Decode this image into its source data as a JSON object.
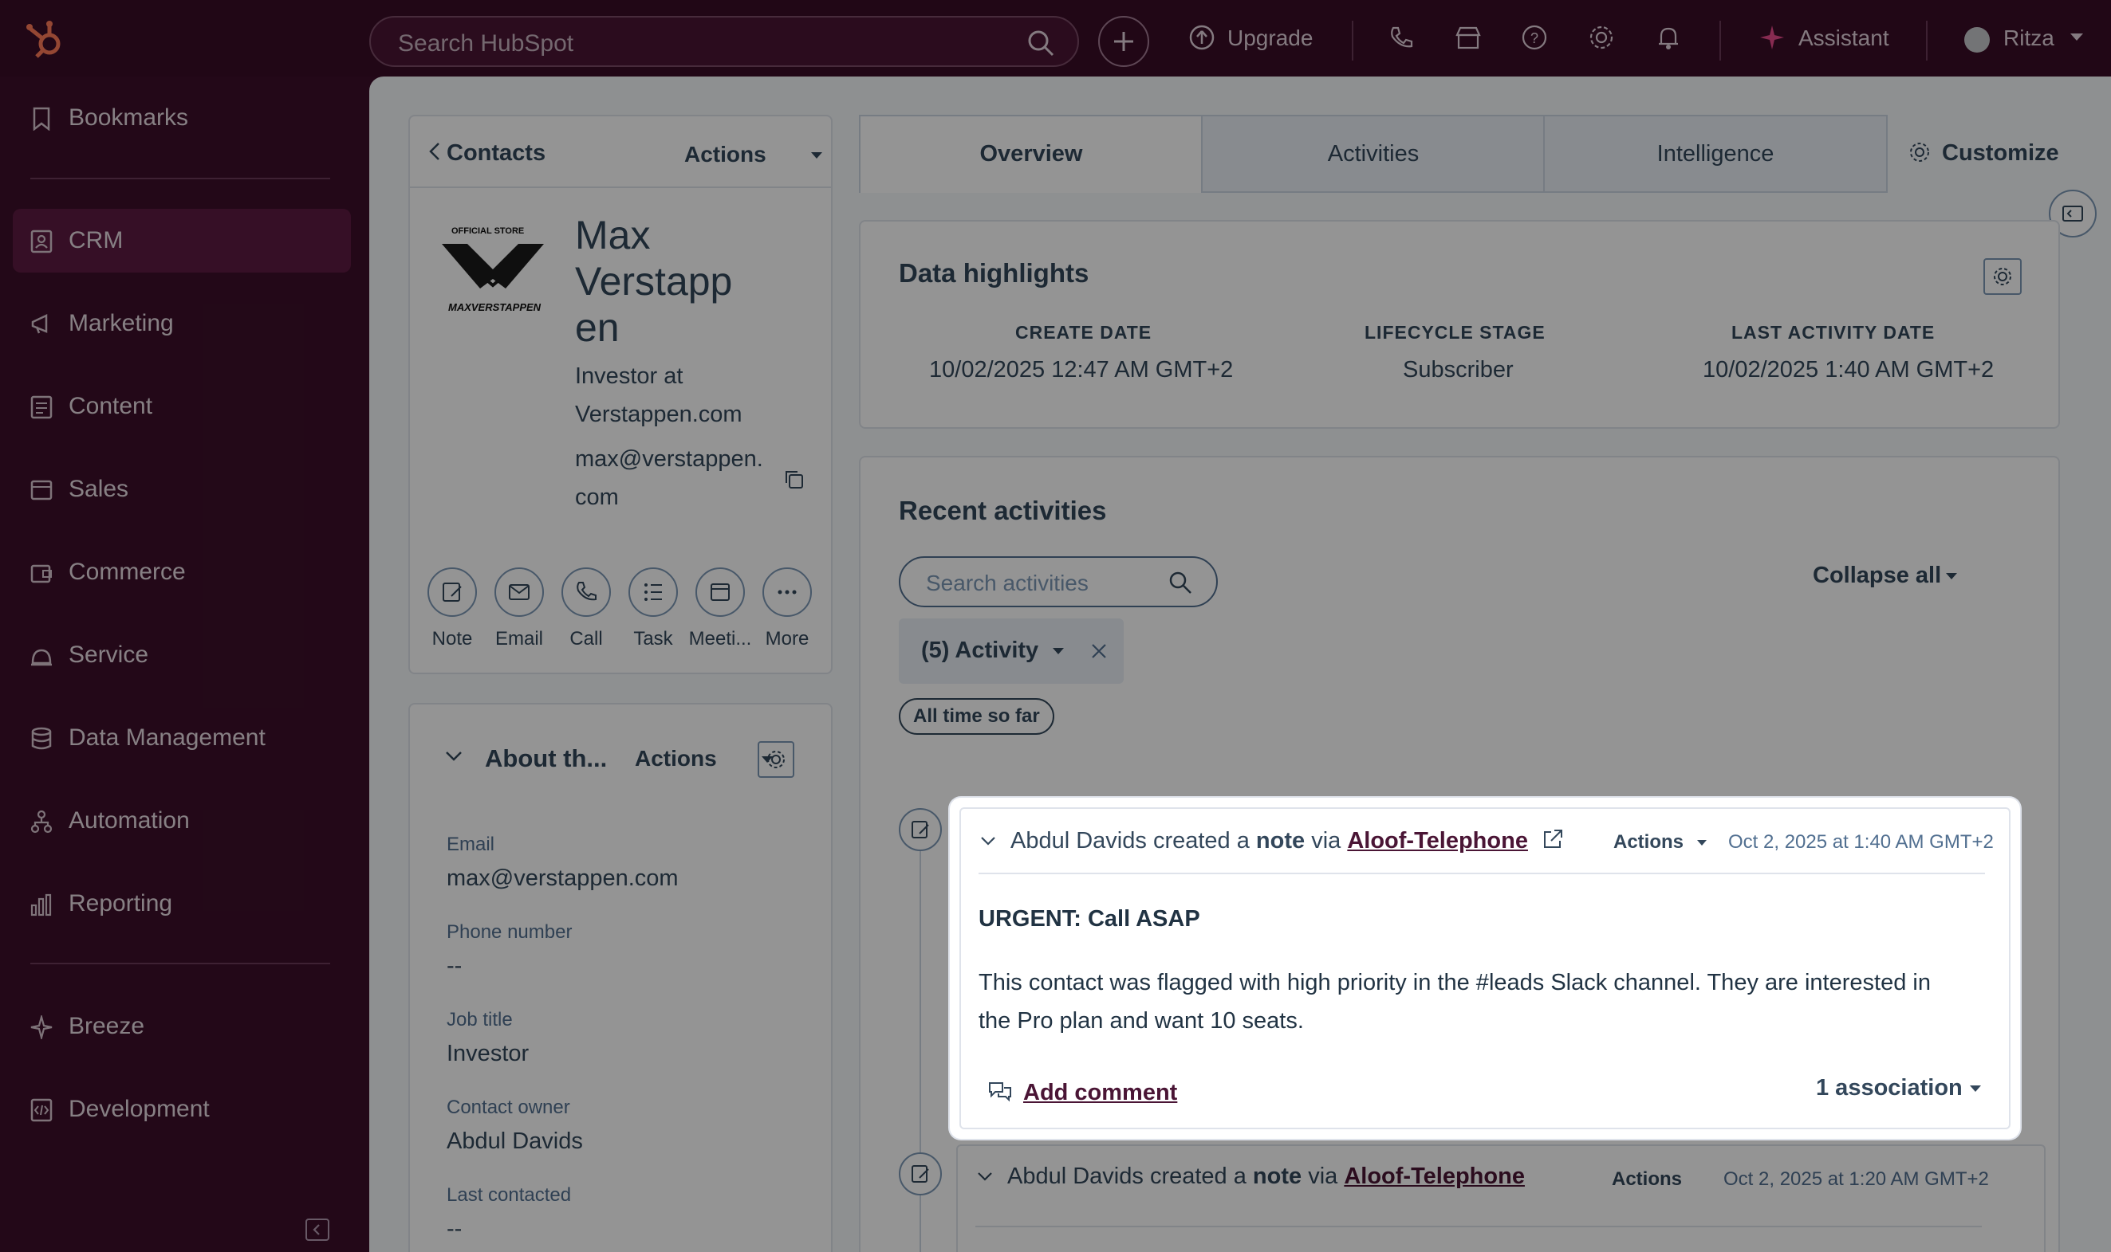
{
  "topbar": {
    "search_placeholder": "Search HubSpot",
    "upgrade": "Upgrade",
    "assistant": "Assistant",
    "user": "Ritza"
  },
  "sidebar": {
    "items": [
      {
        "label": "Bookmarks",
        "icon": "bookmark-icon"
      },
      {
        "label": "CRM",
        "icon": "contacts-icon"
      },
      {
        "label": "Marketing",
        "icon": "megaphone-icon"
      },
      {
        "label": "Content",
        "icon": "content-icon"
      },
      {
        "label": "Sales",
        "icon": "sales-icon"
      },
      {
        "label": "Commerce",
        "icon": "wallet-icon"
      },
      {
        "label": "Service",
        "icon": "service-icon"
      },
      {
        "label": "Data Management",
        "icon": "database-icon"
      },
      {
        "label": "Automation",
        "icon": "automation-icon"
      },
      {
        "label": "Reporting",
        "icon": "reporting-icon"
      },
      {
        "label": "Breeze",
        "icon": "sparkle-icon"
      },
      {
        "label": "Development",
        "icon": "code-icon"
      }
    ]
  },
  "contact": {
    "back_label": "Contacts",
    "actions": "Actions",
    "logo_top": "OFFICIAL STORE",
    "logo_bottom": "MAXVERSTAPPEN",
    "name_l1": "Max",
    "name_l2": "Verstapp",
    "name_l3": "en",
    "role_l1": "Investor at",
    "role_l2": "Verstappen.com",
    "email_l1": "max@verstappen.",
    "email_l2": "com",
    "buttons": [
      "Note",
      "Email",
      "Call",
      "Task",
      "Meeti...",
      "More"
    ]
  },
  "about": {
    "title": "About th...",
    "actions": "Actions",
    "fields": [
      {
        "label": "Email",
        "value": "max@verstappen.com"
      },
      {
        "label": "Phone number",
        "value": "--"
      },
      {
        "label": "Job title",
        "value": "Investor"
      },
      {
        "label": "Contact owner",
        "value": "Abdul Davids"
      },
      {
        "label": "Last contacted",
        "value": "--"
      }
    ]
  },
  "tabs": [
    "Overview",
    "Activities",
    "Intelligence"
  ],
  "customize": "Customize",
  "highlights": {
    "title": "Data highlights",
    "cols": [
      {
        "header": "CREATE DATE",
        "value": "10/02/2025 12:47 AM GMT+2"
      },
      {
        "header": "LIFECYCLE STAGE",
        "value": "Subscriber"
      },
      {
        "header": "LAST ACTIVITY DATE",
        "value": "10/02/2025 1:40 AM GMT+2"
      }
    ]
  },
  "recent": {
    "title": "Recent activities",
    "search_placeholder": "Search activities",
    "collapse_all": "Collapse all",
    "filter": "(5) Activity",
    "time_filter": "All time so far"
  },
  "activities": [
    {
      "author": "Abdul Davids",
      "created": "created a",
      "type": "note",
      "via": "via",
      "source": "Aloof-Telephone",
      "actions": "Actions",
      "time": "Oct 2, 2025 at 1:40 AM GMT+2",
      "subject": "URGENT: Call ASAP",
      "body_l1": "This contact was flagged with high priority in the #leads Slack channel. They are interested in",
      "body_l2": "the Pro plan and want 10 seats.",
      "add_comment": "Add comment",
      "associations": "1 association"
    },
    {
      "author": "Abdul Davids",
      "created": "created a",
      "type": "note",
      "via": "via",
      "source": "Aloof-Telephone",
      "actions": "Actions",
      "time": "Oct 2, 2025 at 1:20 AM GMT+2"
    }
  ]
}
